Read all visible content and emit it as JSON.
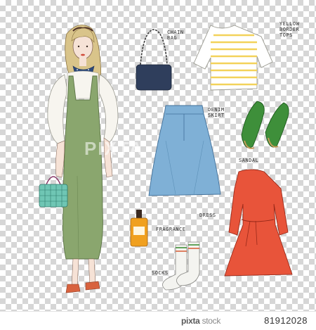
{
  "labels": {
    "chain_bag": "CHAIN\nBAG",
    "yellow_border_tops": "YELLOW\nBORDER\nTOPS",
    "denim_skirt": "DENIM\nSKIRT",
    "sandal": "SANDAL",
    "fragrance": "FRAGRANCE",
    "dress": "DRESS",
    "socks": "SOCKS"
  },
  "footer": {
    "logo_main": "pixta",
    "logo_sub": "stock",
    "image_id": "81912028"
  },
  "watermark": "PIXTA",
  "colors": {
    "jumper": "#8aa66e",
    "shirt": "#f7f5ef",
    "denim": "#7fb0d6",
    "dress": "#e8543a",
    "sandal": "#3e8f3a",
    "stripes": "#f3d25a",
    "bag": "#2f3e5c",
    "basket": "#6fc6b4",
    "fragrance": "#f0a020"
  }
}
